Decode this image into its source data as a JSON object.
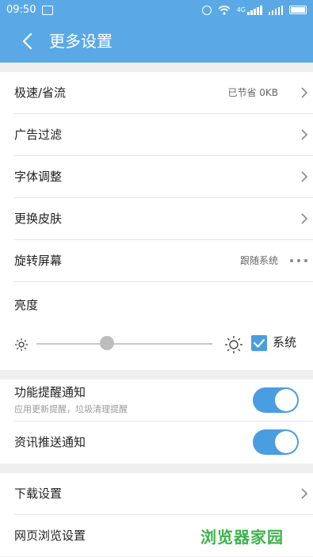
{
  "status_bar": {
    "time": "09:50",
    "network_label": "4G"
  },
  "app_bar": {
    "back_icon": "chevron-left-icon",
    "title": "更多设置"
  },
  "group1": {
    "items": [
      {
        "label": "极速/省流",
        "value": "已节省 0KB",
        "trailing": "chevron-right-icon"
      },
      {
        "label": "广告过滤",
        "value": "",
        "trailing": "chevron-right-icon"
      },
      {
        "label": "字体调整",
        "value": "",
        "trailing": "chevron-right-icon"
      },
      {
        "label": "更换皮肤",
        "value": "",
        "trailing": "chevron-right-icon"
      },
      {
        "label": "旋转屏幕",
        "value": "跟随系统",
        "trailing": "more-dots-icon"
      }
    ],
    "brightness": {
      "label": "亮度",
      "level": 0.4,
      "system_label": "系统",
      "system_checked": true
    }
  },
  "group2": {
    "items": [
      {
        "label": "功能提醒通知",
        "sub": "应用更新提醒，垃圾清理提醒",
        "enabled": true
      },
      {
        "label": "资讯推送通知",
        "sub": "",
        "enabled": true
      }
    ]
  },
  "group3": {
    "items": [
      {
        "label": "下载设置",
        "trailing": "chevron-right-icon"
      },
      {
        "label": "网页浏览设置",
        "trailing": ""
      }
    ]
  },
  "watermark": {
    "text": "浏览器家园"
  },
  "colors": {
    "accent": "#5aa9e6",
    "toggle_on": "#4a9de0",
    "background": "#efefef"
  }
}
